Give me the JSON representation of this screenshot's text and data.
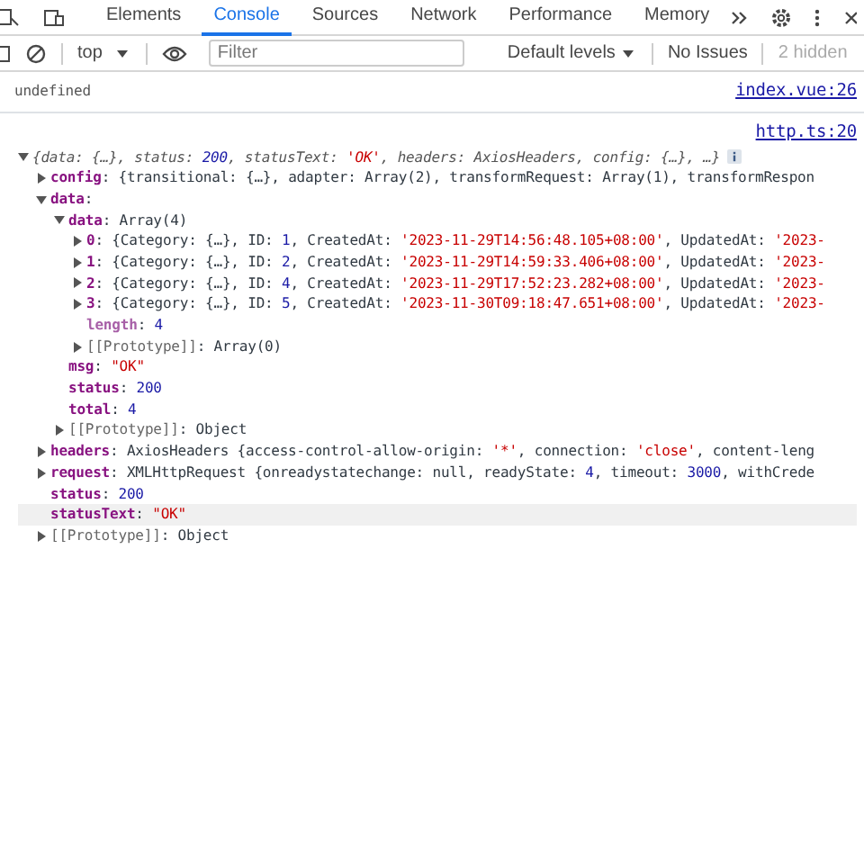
{
  "tabs": [
    {
      "label": "Elements",
      "selected": false
    },
    {
      "label": "Console",
      "selected": true
    },
    {
      "label": "Sources",
      "selected": false
    },
    {
      "label": "Network",
      "selected": false
    },
    {
      "label": "Performance",
      "selected": false
    },
    {
      "label": "Memory",
      "selected": false
    }
  ],
  "toolbar": {
    "context": "top",
    "filter": {
      "placeholder": "Filter"
    },
    "levels": "Default levels",
    "issues": "No Issues",
    "hidden": "2 hidden"
  },
  "messages": [
    {
      "text": "undefined",
      "source": "index.vue:26"
    },
    {
      "source": "http.ts:20",
      "tree": {
        "expanded": true,
        "italic": true,
        "info": true,
        "parts": [
          {
            "kind": "dim",
            "text": "{data: {…}, status: "
          },
          {
            "kind": "num",
            "text": "200"
          },
          {
            "kind": "dim",
            "text": ", statusText: "
          },
          {
            "kind": "str",
            "text": "'OK'"
          },
          {
            "kind": "dim",
            "text": ", headers: AxiosHeaders, config: {…}, …}"
          }
        ],
        "children": [
          {
            "expanded": false,
            "parts": [
              {
                "kind": "key",
                "text": "config"
              },
              {
                "kind": "plain",
                "text": ": {transitional: {…}, adapter: Array(2), transformRequest: Array(1), transformRespon"
              }
            ]
          },
          {
            "expanded": true,
            "parts": [
              {
                "kind": "key",
                "text": "data"
              },
              {
                "kind": "plain",
                "text": ":"
              }
            ],
            "children": [
              {
                "expanded": true,
                "parts": [
                  {
                    "kind": "key",
                    "text": "data"
                  },
                  {
                    "kind": "plain",
                    "text": ": Array(4)"
                  }
                ],
                "children": [
                  {
                    "expanded": false,
                    "parts": [
                      {
                        "kind": "key",
                        "text": "0"
                      },
                      {
                        "kind": "plain",
                        "text": ": {Category: {…}, ID: "
                      },
                      {
                        "kind": "num",
                        "text": "1"
                      },
                      {
                        "kind": "plain",
                        "text": ", CreatedAt: "
                      },
                      {
                        "kind": "str",
                        "text": "'2023-11-29T14:56:48.105+08:00'"
                      },
                      {
                        "kind": "plain",
                        "text": ", UpdatedAt: "
                      },
                      {
                        "kind": "str",
                        "text": "'2023-"
                      }
                    ]
                  },
                  {
                    "expanded": false,
                    "parts": [
                      {
                        "kind": "key",
                        "text": "1"
                      },
                      {
                        "kind": "plain",
                        "text": ": {Category: {…}, ID: "
                      },
                      {
                        "kind": "num",
                        "text": "2"
                      },
                      {
                        "kind": "plain",
                        "text": ", CreatedAt: "
                      },
                      {
                        "kind": "str",
                        "text": "'2023-11-29T14:59:33.406+08:00'"
                      },
                      {
                        "kind": "plain",
                        "text": ", UpdatedAt: "
                      },
                      {
                        "kind": "str",
                        "text": "'2023-"
                      }
                    ]
                  },
                  {
                    "expanded": false,
                    "parts": [
                      {
                        "kind": "key",
                        "text": "2"
                      },
                      {
                        "kind": "plain",
                        "text": ": {Category: {…}, ID: "
                      },
                      {
                        "kind": "num",
                        "text": "4"
                      },
                      {
                        "kind": "plain",
                        "text": ", CreatedAt: "
                      },
                      {
                        "kind": "str",
                        "text": "'2023-11-29T17:52:23.282+08:00'"
                      },
                      {
                        "kind": "plain",
                        "text": ", UpdatedAt: "
                      },
                      {
                        "kind": "str",
                        "text": "'2023-"
                      }
                    ]
                  },
                  {
                    "expanded": false,
                    "parts": [
                      {
                        "kind": "key",
                        "text": "3"
                      },
                      {
                        "kind": "plain",
                        "text": ": {Category: {…}, ID: "
                      },
                      {
                        "kind": "num",
                        "text": "5"
                      },
                      {
                        "kind": "plain",
                        "text": ", CreatedAt: "
                      },
                      {
                        "kind": "str",
                        "text": "'2023-11-30T09:18:47.651+08:00'"
                      },
                      {
                        "kind": "plain",
                        "text": ", UpdatedAt: "
                      },
                      {
                        "kind": "str",
                        "text": "'2023-"
                      }
                    ]
                  },
                  {
                    "parts": [
                      {
                        "kind": "softkey",
                        "text": "length"
                      },
                      {
                        "kind": "plain",
                        "text": ": "
                      },
                      {
                        "kind": "num",
                        "text": "4"
                      }
                    ]
                  },
                  {
                    "expanded": false,
                    "parts": [
                      {
                        "kind": "proto",
                        "text": "[[Prototype]]"
                      },
                      {
                        "kind": "plain",
                        "text": ": Array(0)"
                      }
                    ]
                  }
                ]
              },
              {
                "parts": [
                  {
                    "kind": "key",
                    "text": "msg"
                  },
                  {
                    "kind": "plain",
                    "text": ": "
                  },
                  {
                    "kind": "str",
                    "text": "\"OK\""
                  }
                ]
              },
              {
                "parts": [
                  {
                    "kind": "key",
                    "text": "status"
                  },
                  {
                    "kind": "plain",
                    "text": ": "
                  },
                  {
                    "kind": "num",
                    "text": "200"
                  }
                ]
              },
              {
                "parts": [
                  {
                    "kind": "key",
                    "text": "total"
                  },
                  {
                    "kind": "plain",
                    "text": ": "
                  },
                  {
                    "kind": "num",
                    "text": "4"
                  }
                ]
              },
              {
                "expanded": false,
                "parts": [
                  {
                    "kind": "proto",
                    "text": "[[Prototype]]"
                  },
                  {
                    "kind": "plain",
                    "text": ": Object"
                  }
                ]
              }
            ]
          },
          {
            "expanded": false,
            "parts": [
              {
                "kind": "key",
                "text": "headers"
              },
              {
                "kind": "plain",
                "text": ": AxiosHeaders {access-control-allow-origin: "
              },
              {
                "kind": "str",
                "text": "'*'"
              },
              {
                "kind": "plain",
                "text": ", connection: "
              },
              {
                "kind": "str",
                "text": "'close'"
              },
              {
                "kind": "plain",
                "text": ", content-leng"
              }
            ]
          },
          {
            "expanded": false,
            "parts": [
              {
                "kind": "key",
                "text": "request"
              },
              {
                "kind": "plain",
                "text": ": XMLHttpRequest {onreadystatechange: null, readyState: "
              },
              {
                "kind": "num",
                "text": "4"
              },
              {
                "kind": "plain",
                "text": ", timeout: "
              },
              {
                "kind": "num",
                "text": "3000"
              },
              {
                "kind": "plain",
                "text": ", withCrede"
              }
            ]
          },
          {
            "parts": [
              {
                "kind": "key",
                "text": "status"
              },
              {
                "kind": "plain",
                "text": ": "
              },
              {
                "kind": "num",
                "text": "200"
              }
            ]
          },
          {
            "highlighted": true,
            "parts": [
              {
                "kind": "key",
                "text": "statusText"
              },
              {
                "kind": "plain",
                "text": ": "
              },
              {
                "kind": "str",
                "text": "\"OK\""
              }
            ]
          },
          {
            "expanded": false,
            "parts": [
              {
                "kind": "proto",
                "text": "[[Prototype]]"
              },
              {
                "kind": "plain",
                "text": ": Object"
              }
            ]
          }
        ]
      }
    }
  ]
}
